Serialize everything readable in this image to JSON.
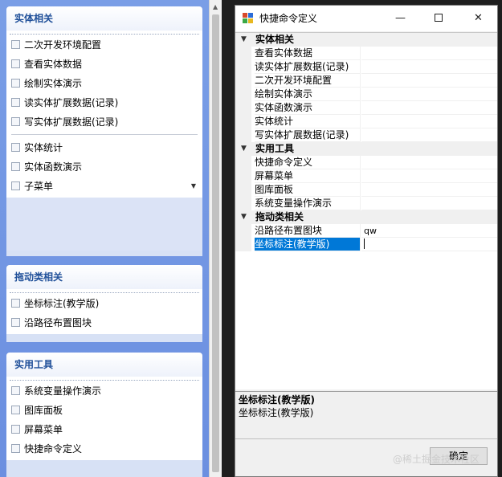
{
  "taskpane": {
    "groups": [
      {
        "title": "实体相关",
        "items": [
          "二次开发环境配置",
          "查看实体数据",
          "绘制实体演示",
          "读实体扩展数据(记录)",
          "写实体扩展数据(记录)",
          "实体统计",
          "实体函数演示",
          "子菜单"
        ]
      },
      {
        "title": "拖动类相关",
        "items": [
          "坐标标注(教学版)",
          "沿路径布置图块"
        ]
      },
      {
        "title": "实用工具",
        "items": [
          "系统变量操作演示",
          "图库面板",
          "屏幕菜单",
          "快捷命令定义"
        ]
      }
    ]
  },
  "dialog": {
    "title": "快捷命令定义",
    "categories": [
      {
        "name": "实体相关",
        "rows": [
          {
            "name": "查看实体数据",
            "value": ""
          },
          {
            "name": "读实体扩展数据(记录)",
            "value": ""
          },
          {
            "name": "二次开发环境配置",
            "value": ""
          },
          {
            "name": "绘制实体演示",
            "value": ""
          },
          {
            "name": "实体函数演示",
            "value": ""
          },
          {
            "name": "实体统计",
            "value": ""
          },
          {
            "name": "写实体扩展数据(记录)",
            "value": ""
          }
        ]
      },
      {
        "name": "实用工具",
        "rows": [
          {
            "name": "快捷命令定义",
            "value": ""
          },
          {
            "name": "屏幕菜单",
            "value": ""
          },
          {
            "name": "图库面板",
            "value": ""
          },
          {
            "name": "系统变量操作演示",
            "value": ""
          }
        ]
      },
      {
        "name": "拖动类相关",
        "rows": [
          {
            "name": "沿路径布置图块",
            "value": "qw"
          },
          {
            "name": "坐标标注(教学版)",
            "value": ""
          }
        ]
      }
    ],
    "description": {
      "title": "坐标标注(教学版)",
      "text": "坐标标注(教学版)"
    },
    "ok_label": "确定"
  },
  "watermark": "@稀土掘金技术社区",
  "colors": {
    "selection": "#0078d7",
    "group_header_text": "#1f4f99",
    "pane_bg": "#7a9ee6"
  }
}
